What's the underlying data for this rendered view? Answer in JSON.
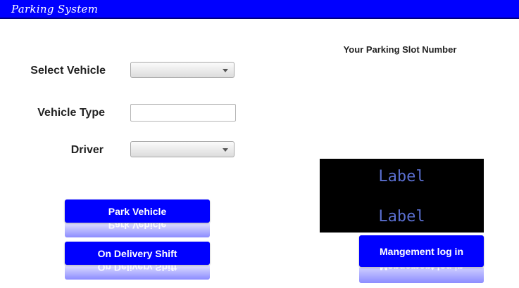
{
  "window": {
    "title": "Parking System"
  },
  "form": {
    "select_vehicle_label": "Select Vehicle",
    "vehicle_type_label": "Vehicle Type",
    "vehicle_type_value": "",
    "driver_label": "Driver"
  },
  "buttons": {
    "park_vehicle": "Park Vehicle",
    "on_delivery_shift": "On Delivery Shift",
    "management_login": "Mangement log in"
  },
  "slot": {
    "title": "Your Parking Slot Number",
    "label_1": "Label",
    "label_2": "Label"
  },
  "colors": {
    "accent": "#0000ff",
    "display_bg": "#000000",
    "display_text": "#5a6fd0"
  }
}
